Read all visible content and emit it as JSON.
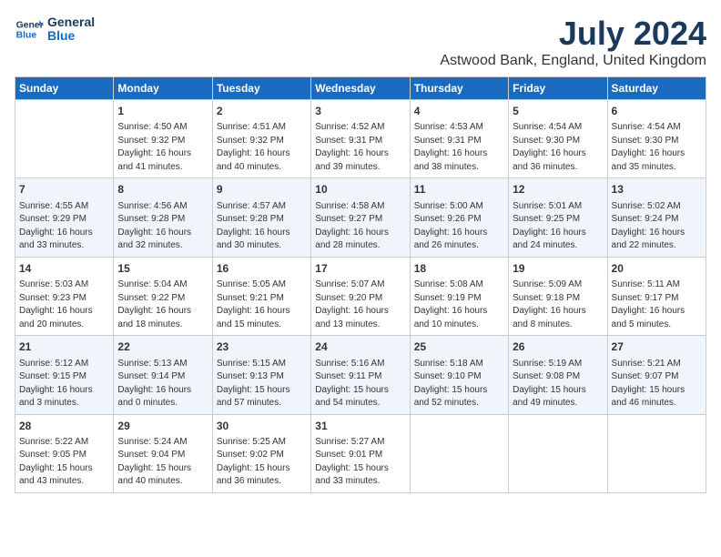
{
  "header": {
    "logo_line1": "General",
    "logo_line2": "Blue",
    "month_year": "July 2024",
    "location": "Astwood Bank, England, United Kingdom"
  },
  "days_of_week": [
    "Sunday",
    "Monday",
    "Tuesday",
    "Wednesday",
    "Thursday",
    "Friday",
    "Saturday"
  ],
  "weeks": [
    [
      {
        "day": "",
        "content": ""
      },
      {
        "day": "1",
        "content": "Sunrise: 4:50 AM\nSunset: 9:32 PM\nDaylight: 16 hours\nand 41 minutes."
      },
      {
        "day": "2",
        "content": "Sunrise: 4:51 AM\nSunset: 9:32 PM\nDaylight: 16 hours\nand 40 minutes."
      },
      {
        "day": "3",
        "content": "Sunrise: 4:52 AM\nSunset: 9:31 PM\nDaylight: 16 hours\nand 39 minutes."
      },
      {
        "day": "4",
        "content": "Sunrise: 4:53 AM\nSunset: 9:31 PM\nDaylight: 16 hours\nand 38 minutes."
      },
      {
        "day": "5",
        "content": "Sunrise: 4:54 AM\nSunset: 9:30 PM\nDaylight: 16 hours\nand 36 minutes."
      },
      {
        "day": "6",
        "content": "Sunrise: 4:54 AM\nSunset: 9:30 PM\nDaylight: 16 hours\nand 35 minutes."
      }
    ],
    [
      {
        "day": "7",
        "content": "Sunrise: 4:55 AM\nSunset: 9:29 PM\nDaylight: 16 hours\nand 33 minutes."
      },
      {
        "day": "8",
        "content": "Sunrise: 4:56 AM\nSunset: 9:28 PM\nDaylight: 16 hours\nand 32 minutes."
      },
      {
        "day": "9",
        "content": "Sunrise: 4:57 AM\nSunset: 9:28 PM\nDaylight: 16 hours\nand 30 minutes."
      },
      {
        "day": "10",
        "content": "Sunrise: 4:58 AM\nSunset: 9:27 PM\nDaylight: 16 hours\nand 28 minutes."
      },
      {
        "day": "11",
        "content": "Sunrise: 5:00 AM\nSunset: 9:26 PM\nDaylight: 16 hours\nand 26 minutes."
      },
      {
        "day": "12",
        "content": "Sunrise: 5:01 AM\nSunset: 9:25 PM\nDaylight: 16 hours\nand 24 minutes."
      },
      {
        "day": "13",
        "content": "Sunrise: 5:02 AM\nSunset: 9:24 PM\nDaylight: 16 hours\nand 22 minutes."
      }
    ],
    [
      {
        "day": "14",
        "content": "Sunrise: 5:03 AM\nSunset: 9:23 PM\nDaylight: 16 hours\nand 20 minutes."
      },
      {
        "day": "15",
        "content": "Sunrise: 5:04 AM\nSunset: 9:22 PM\nDaylight: 16 hours\nand 18 minutes."
      },
      {
        "day": "16",
        "content": "Sunrise: 5:05 AM\nSunset: 9:21 PM\nDaylight: 16 hours\nand 15 minutes."
      },
      {
        "day": "17",
        "content": "Sunrise: 5:07 AM\nSunset: 9:20 PM\nDaylight: 16 hours\nand 13 minutes."
      },
      {
        "day": "18",
        "content": "Sunrise: 5:08 AM\nSunset: 9:19 PM\nDaylight: 16 hours\nand 10 minutes."
      },
      {
        "day": "19",
        "content": "Sunrise: 5:09 AM\nSunset: 9:18 PM\nDaylight: 16 hours\nand 8 minutes."
      },
      {
        "day": "20",
        "content": "Sunrise: 5:11 AM\nSunset: 9:17 PM\nDaylight: 16 hours\nand 5 minutes."
      }
    ],
    [
      {
        "day": "21",
        "content": "Sunrise: 5:12 AM\nSunset: 9:15 PM\nDaylight: 16 hours\nand 3 minutes."
      },
      {
        "day": "22",
        "content": "Sunrise: 5:13 AM\nSunset: 9:14 PM\nDaylight: 16 hours\nand 0 minutes."
      },
      {
        "day": "23",
        "content": "Sunrise: 5:15 AM\nSunset: 9:13 PM\nDaylight: 15 hours\nand 57 minutes."
      },
      {
        "day": "24",
        "content": "Sunrise: 5:16 AM\nSunset: 9:11 PM\nDaylight: 15 hours\nand 54 minutes."
      },
      {
        "day": "25",
        "content": "Sunrise: 5:18 AM\nSunset: 9:10 PM\nDaylight: 15 hours\nand 52 minutes."
      },
      {
        "day": "26",
        "content": "Sunrise: 5:19 AM\nSunset: 9:08 PM\nDaylight: 15 hours\nand 49 minutes."
      },
      {
        "day": "27",
        "content": "Sunrise: 5:21 AM\nSunset: 9:07 PM\nDaylight: 15 hours\nand 46 minutes."
      }
    ],
    [
      {
        "day": "28",
        "content": "Sunrise: 5:22 AM\nSunset: 9:05 PM\nDaylight: 15 hours\nand 43 minutes."
      },
      {
        "day": "29",
        "content": "Sunrise: 5:24 AM\nSunset: 9:04 PM\nDaylight: 15 hours\nand 40 minutes."
      },
      {
        "day": "30",
        "content": "Sunrise: 5:25 AM\nSunset: 9:02 PM\nDaylight: 15 hours\nand 36 minutes."
      },
      {
        "day": "31",
        "content": "Sunrise: 5:27 AM\nSunset: 9:01 PM\nDaylight: 15 hours\nand 33 minutes."
      },
      {
        "day": "",
        "content": ""
      },
      {
        "day": "",
        "content": ""
      },
      {
        "day": "",
        "content": ""
      }
    ]
  ]
}
